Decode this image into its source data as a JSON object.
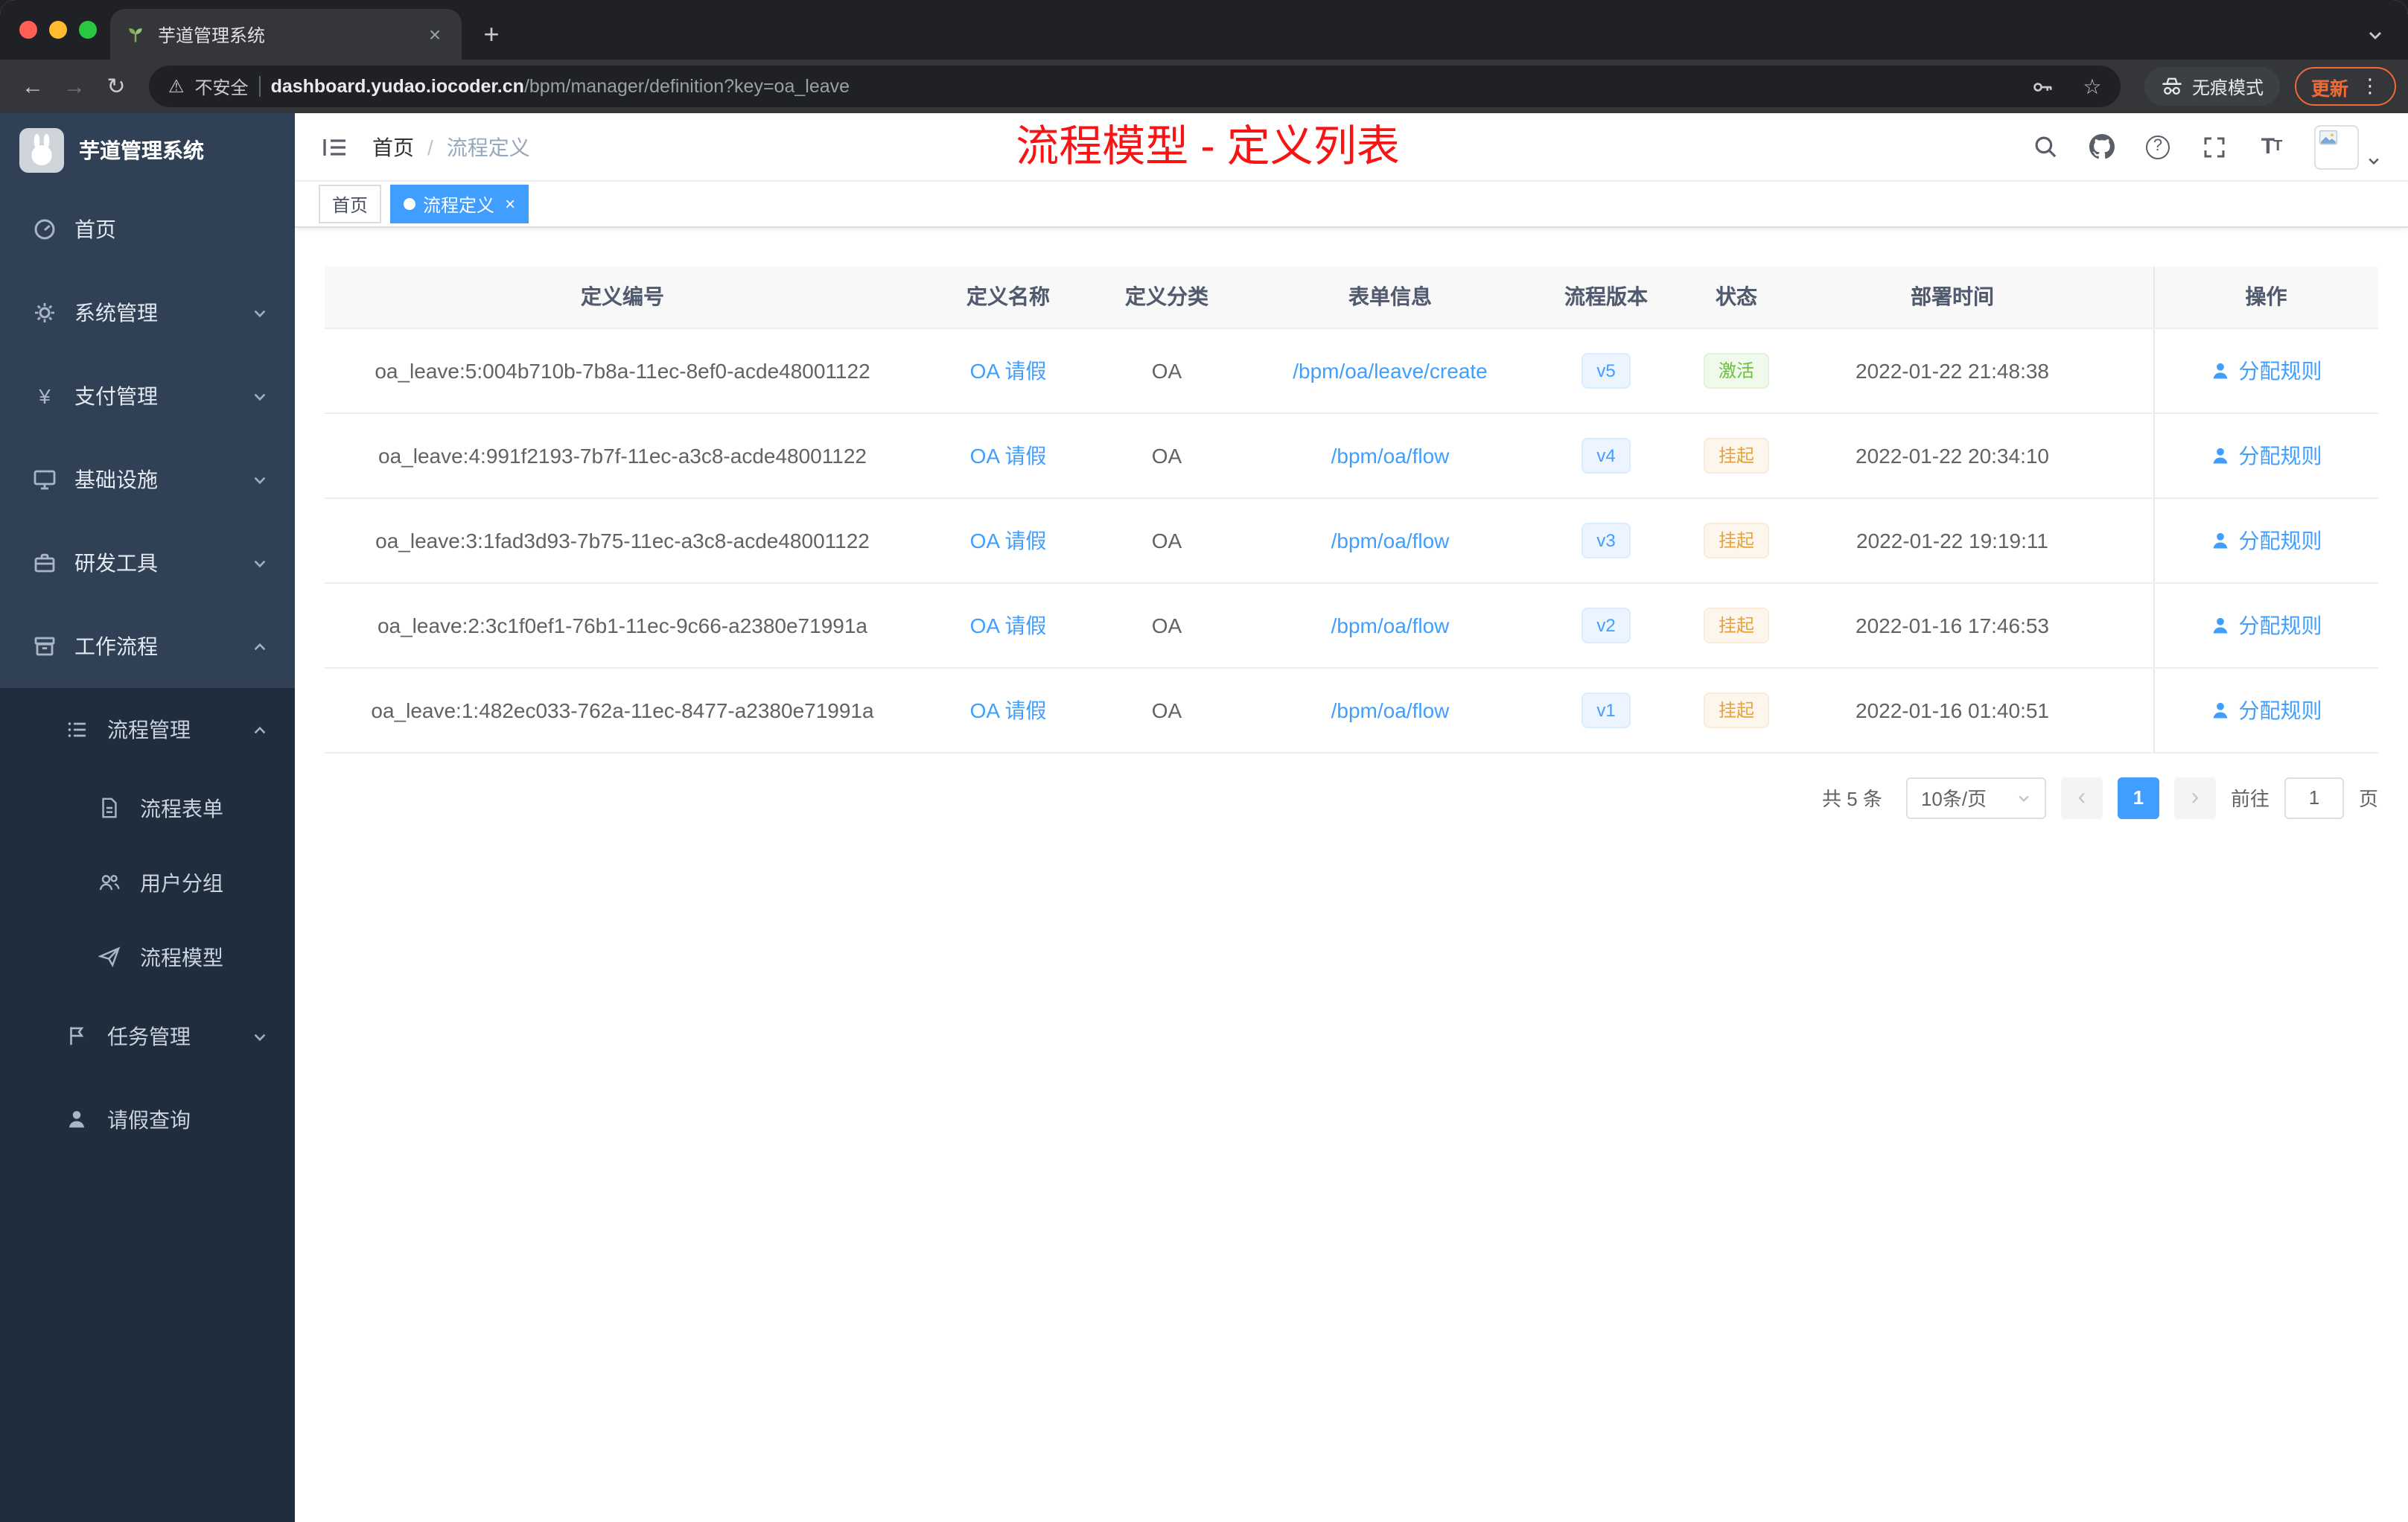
{
  "browser": {
    "tab_title": "芋道管理系统",
    "security_label": "不安全",
    "url_domain": "dashboard.yudao.iocoder.cn",
    "url_path": "/bpm/manager/definition?key=oa_leave",
    "incognito_label": "无痕模式",
    "update_label": "更新"
  },
  "icons": {
    "plus": "+",
    "close": "×",
    "back": "←",
    "forward": "→",
    "reload": "↻",
    "warning": "⚠",
    "star": "☆",
    "dots": "⋮",
    "yen": "¥",
    "question": "?",
    "t_large": "T",
    "t_small": "T",
    "page_prev": "‹",
    "page_next": "›"
  },
  "sidebar": {
    "logo_title": "芋道管理系统",
    "items": [
      "首页",
      "系统管理",
      "支付管理",
      "基础设施",
      "研发工具",
      "工作流程",
      "流程管理",
      "流程表单",
      "用户分组",
      "流程模型",
      "任务管理",
      "请假查询"
    ]
  },
  "header": {
    "breadcrumb_home": "首页",
    "breadcrumb_sep": "/",
    "breadcrumb_current": "流程定义",
    "annotation_title": "流程模型 - 定义列表"
  },
  "tags": {
    "items": [
      {
        "label": "首页",
        "active": false
      },
      {
        "label": "流程定义",
        "active": true
      }
    ]
  },
  "table": {
    "columns": [
      "定义编号",
      "定义名称",
      "定义分类",
      "表单信息",
      "流程版本",
      "状态",
      "部署时间",
      "操作"
    ],
    "rows": [
      {
        "id": "oa_leave:5:004b710b-7b8a-11ec-8ef0-acde48001122",
        "name": "OA 请假",
        "category": "OA",
        "form": "/bpm/oa/leave/create",
        "version": "v5",
        "status": "激活",
        "status_type": "success",
        "deploy_time": "2022-01-22 21:48:38",
        "action": "分配规则"
      },
      {
        "id": "oa_leave:4:991f2193-7b7f-11ec-a3c8-acde48001122",
        "name": "OA 请假",
        "category": "OA",
        "form": "/bpm/oa/flow",
        "version": "v4",
        "status": "挂起",
        "status_type": "warning",
        "deploy_time": "2022-01-22 20:34:10",
        "action": "分配规则"
      },
      {
        "id": "oa_leave:3:1fad3d93-7b75-11ec-a3c8-acde48001122",
        "name": "OA 请假",
        "category": "OA",
        "form": "/bpm/oa/flow",
        "version": "v3",
        "status": "挂起",
        "status_type": "warning",
        "deploy_time": "2022-01-22 19:19:11",
        "action": "分配规则"
      },
      {
        "id": "oa_leave:2:3c1f0ef1-76b1-11ec-9c66-a2380e71991a",
        "name": "OA 请假",
        "category": "OA",
        "form": "/bpm/oa/flow",
        "version": "v2",
        "status": "挂起",
        "status_type": "warning",
        "deploy_time": "2022-01-16 17:46:53",
        "action": "分配规则"
      },
      {
        "id": "oa_leave:1:482ec033-762a-11ec-8477-a2380e71991a",
        "name": "OA 请假",
        "category": "OA",
        "form": "/bpm/oa/flow",
        "version": "v1",
        "status": "挂起",
        "status_type": "warning",
        "deploy_time": "2022-01-16 01:40:51",
        "action": "分配规则"
      }
    ]
  },
  "pagination": {
    "total_label": "共 5 条",
    "page_size_label": "10条/页",
    "current_page": "1",
    "goto_prefix": "前往",
    "goto_value": "1",
    "goto_suffix": "页"
  },
  "colors": {
    "primary": "#409eff",
    "success": "#67c23a",
    "warning": "#e6a23c",
    "annotation_red": "#f81414",
    "sidebar_bg": "#304156",
    "sidebar_sub_bg": "#1f2d3d"
  }
}
